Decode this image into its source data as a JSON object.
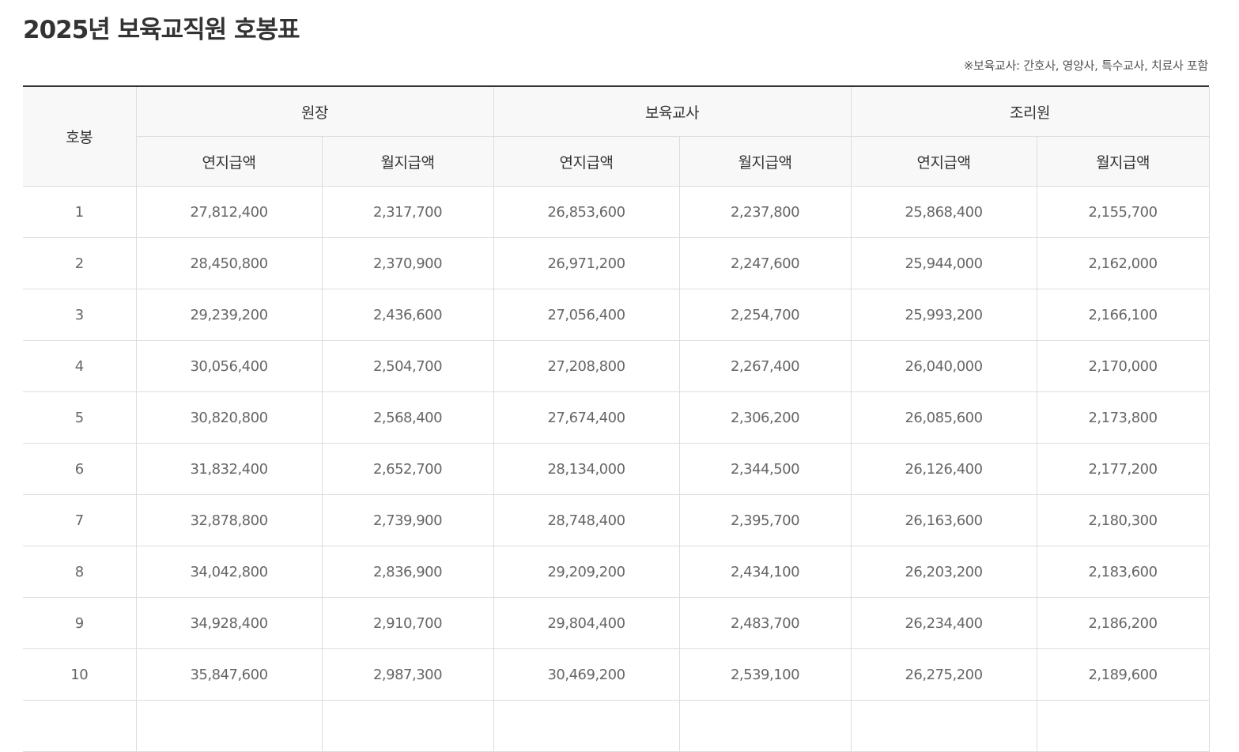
{
  "page": {
    "title": "2025년 보육교직원 호봉표",
    "note": "※보육교사: 간호사, 영양사, 특수교사, 치료사 포함"
  },
  "table": {
    "step_header": "호봉",
    "groups": [
      "원장",
      "보육교사",
      "조리원"
    ],
    "sub_headers": [
      "연지급액",
      "월지급액",
      "연지급액",
      "월지급액",
      "연지급액",
      "월지급액"
    ],
    "rows": [
      [
        "1",
        "27,812,400",
        "2,317,700",
        "26,853,600",
        "2,237,800",
        "25,868,400",
        "2,155,700"
      ],
      [
        "2",
        "28,450,800",
        "2,370,900",
        "26,971,200",
        "2,247,600",
        "25,944,000",
        "2,162,000"
      ],
      [
        "3",
        "29,239,200",
        "2,436,600",
        "27,056,400",
        "2,254,700",
        "25,993,200",
        "2,166,100"
      ],
      [
        "4",
        "30,056,400",
        "2,504,700",
        "27,208,800",
        "2,267,400",
        "26,040,000",
        "2,170,000"
      ],
      [
        "5",
        "30,820,800",
        "2,568,400",
        "27,674,400",
        "2,306,200",
        "26,085,600",
        "2,173,800"
      ],
      [
        "6",
        "31,832,400",
        "2,652,700",
        "28,134,000",
        "2,344,500",
        "26,126,400",
        "2,177,200"
      ],
      [
        "7",
        "32,878,800",
        "2,739,900",
        "28,748,400",
        "2,395,700",
        "26,163,600",
        "2,180,300"
      ],
      [
        "8",
        "34,042,800",
        "2,836,900",
        "29,209,200",
        "2,434,100",
        "26,203,200",
        "2,183,600"
      ],
      [
        "9",
        "34,928,400",
        "2,910,700",
        "29,804,400",
        "2,483,700",
        "26,234,400",
        "2,186,200"
      ],
      [
        "10",
        "35,847,600",
        "2,987,300",
        "30,469,200",
        "2,539,100",
        "26,275,200",
        "2,189,600"
      ],
      [
        "",
        "",
        "",
        "",
        "",
        "",
        ""
      ]
    ]
  }
}
